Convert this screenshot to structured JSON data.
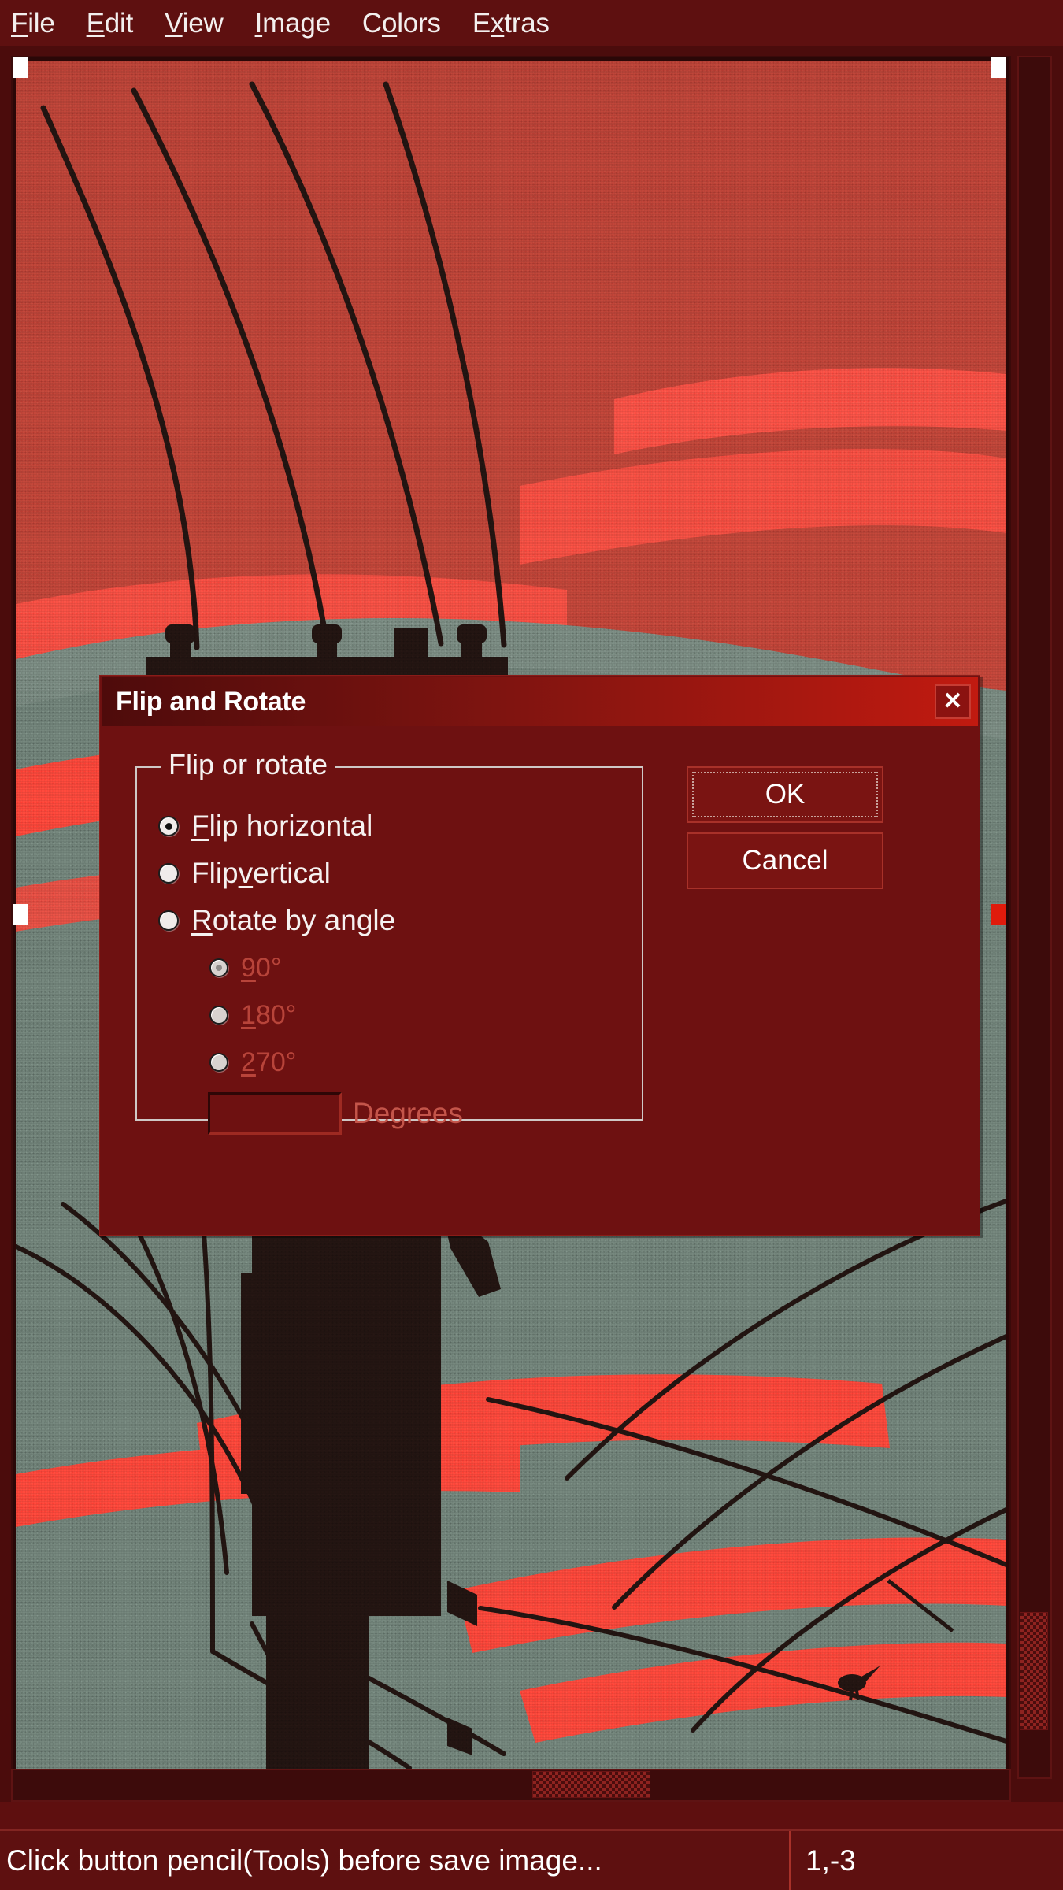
{
  "app": {
    "background_color": "#5e0f0f",
    "accent_color": "#c11a10"
  },
  "menubar": {
    "items": [
      {
        "name": "file",
        "pre": "",
        "mnemonic": "F",
        "post": "ile"
      },
      {
        "name": "edit",
        "pre": "",
        "mnemonic": "E",
        "post": "dit"
      },
      {
        "name": "view",
        "pre": "",
        "mnemonic": "V",
        "post": "iew"
      },
      {
        "name": "image",
        "pre": "",
        "mnemonic": "I",
        "post": "mage"
      },
      {
        "name": "colors",
        "pre": "C",
        "mnemonic": "o",
        "post": "lors"
      },
      {
        "name": "extras",
        "pre": "E",
        "mnemonic": "x",
        "post": "tras"
      }
    ]
  },
  "dialog": {
    "title": "Flip and Rotate",
    "close_label": "✕",
    "group": {
      "legend": "Flip or rotate",
      "options": [
        {
          "pre": "",
          "mnemonic": "F",
          "post": "lip horizontal",
          "selected": true,
          "disabled": false
        },
        {
          "pre": "Flip ",
          "mnemonic": "v",
          "post": "ertical",
          "selected": false,
          "disabled": false
        },
        {
          "pre": "",
          "mnemonic": "R",
          "post": "otate by angle",
          "selected": false,
          "disabled": false
        }
      ],
      "sub_options": [
        {
          "pre": "",
          "mnemonic": "9",
          "post": "0°",
          "selected": true,
          "disabled": true
        },
        {
          "pre": "",
          "mnemonic": "1",
          "post": "80°",
          "selected": false,
          "disabled": true
        },
        {
          "pre": "",
          "mnemonic": "2",
          "post": "70°",
          "selected": false,
          "disabled": true
        }
      ],
      "degrees": {
        "value": "",
        "placeholder": "",
        "label": "Degrees",
        "disabled": true
      }
    },
    "buttons": {
      "ok": "OK",
      "cancel": "Cancel"
    }
  },
  "statusbar": {
    "message": "Click button pencil(Tools) before save image...",
    "coordinates": "1,-3"
  },
  "canvas": {
    "artwork_description": "utility-pole-at-red-sunset",
    "sky_top_color": "#c2483c",
    "sky_bottom_color": "#ff4a3d",
    "cloud_color": "#7e8f86",
    "silhouette_color": "#241512"
  }
}
